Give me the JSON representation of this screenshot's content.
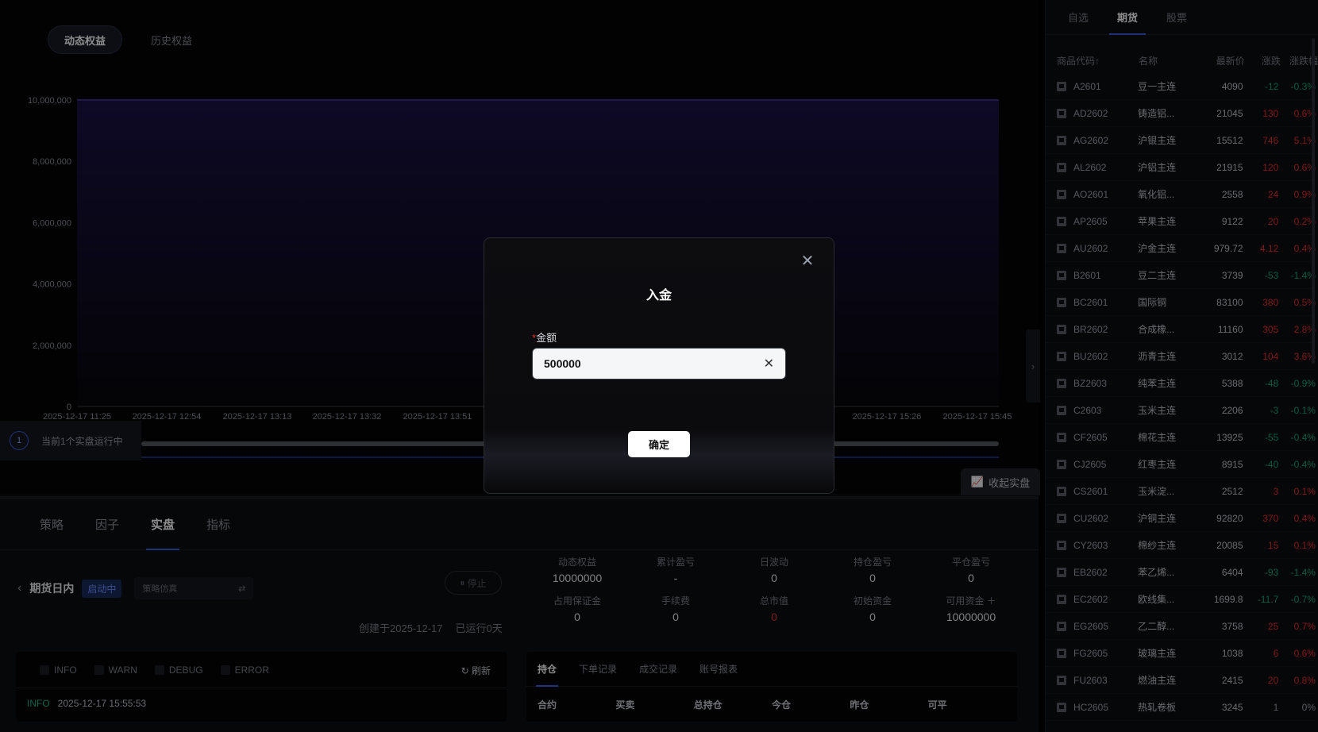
{
  "chart_tabs": [
    "动态权益",
    "历史权益"
  ],
  "chart_data": {
    "type": "area",
    "title": "",
    "xlabel": "",
    "ylabel": "",
    "y_ticks": [
      "0",
      "2,000,000",
      "4,000,000",
      "6,000,000",
      "8,000,000",
      "10,000,000"
    ],
    "x_ticks": [
      "2025-12-17 11:25",
      "2025-12-17 12:54",
      "2025-12-17 13:13",
      "2025-12-17 13:32",
      "2025-12-17 13:51",
      "2025-12-17 15:26",
      "2025-12-17 15:45"
    ],
    "ylim": [
      0,
      10000000
    ],
    "series": [
      {
        "values": [
          10000000,
          10000000
        ]
      }
    ],
    "color": "#3b2a8a"
  },
  "running_badge": {
    "count": "1",
    "text": "当前1个实盘运行中"
  },
  "collapse_label": "收起实盘",
  "bottom_tabs": [
    "策略",
    "因子",
    "实盘",
    "指标"
  ],
  "strategy": {
    "name": "期货日内",
    "status": "启动中",
    "select_placeholder": "策略仿真",
    "stop_label": "停止",
    "created": "创建于2025-12-17",
    "running": "已运行0天"
  },
  "log": {
    "filters": [
      "INFO",
      "WARN",
      "DEBUG",
      "ERROR"
    ],
    "refresh": "刷新",
    "line": {
      "level": "INFO",
      "time": "2025-12-17 15:55:53"
    }
  },
  "stats": [
    {
      "label": "动态权益",
      "value": "10000000"
    },
    {
      "label": "累计盈亏",
      "value": "-"
    },
    {
      "label": "日波动",
      "value": "0"
    },
    {
      "label": "持仓盈亏",
      "value": "0"
    },
    {
      "label": "平仓盈亏",
      "value": "0"
    },
    {
      "label": "占用保证金",
      "value": "0"
    },
    {
      "label": "手续费",
      "value": "0"
    },
    {
      "label": "总市值",
      "value": "0"
    },
    {
      "label": "初始资金",
      "value": "0"
    },
    {
      "label": "可用资金",
      "value": "10000000"
    }
  ],
  "positions": {
    "tabs": [
      "持仓",
      "下单记录",
      "成交记录",
      "账号报表"
    ],
    "headers": [
      "合约",
      "买卖",
      "总持仓",
      "今仓",
      "昨仓",
      "可平"
    ]
  },
  "side": {
    "tabs": [
      "自选",
      "期货",
      "股票"
    ],
    "headers": [
      "商品代码↑",
      "名称",
      "最新价",
      "涨跌",
      "涨跌幅"
    ],
    "rows": [
      [
        "A2601",
        "豆一主连",
        "4090",
        "-12",
        "-0.3%",
        "down"
      ],
      [
        "AD2602",
        "铸造铝...",
        "21045",
        "130",
        "0.6%",
        "up"
      ],
      [
        "AG2602",
        "沪银主连",
        "15512",
        "746",
        "5.1%",
        "up"
      ],
      [
        "AL2602",
        "沪铝主连",
        "21915",
        "120",
        "0.6%",
        "up"
      ],
      [
        "AO2601",
        "氧化铝...",
        "2558",
        "24",
        "0.9%",
        "up"
      ],
      [
        "AP2605",
        "苹果主连",
        "9122",
        "20",
        "0.2%",
        "up"
      ],
      [
        "AU2602",
        "沪金主连",
        "979.72",
        "4.12",
        "0.4%",
        "up"
      ],
      [
        "B2601",
        "豆二主连",
        "3739",
        "-53",
        "-1.4%",
        "down"
      ],
      [
        "BC2601",
        "国际铜",
        "83100",
        "380",
        "0.5%",
        "up"
      ],
      [
        "BR2602",
        "合成橡...",
        "11160",
        "305",
        "2.8%",
        "up"
      ],
      [
        "BU2602",
        "沥青主连",
        "3012",
        "104",
        "3.6%",
        "up"
      ],
      [
        "BZ2603",
        "纯苯主连",
        "5388",
        "-48",
        "-0.9%",
        "down"
      ],
      [
        "C2603",
        "玉米主连",
        "2206",
        "-3",
        "-0.1%",
        "down"
      ],
      [
        "CF2605",
        "棉花主连",
        "13925",
        "-55",
        "-0.4%",
        "down"
      ],
      [
        "CJ2605",
        "红枣主连",
        "8915",
        "-40",
        "-0.4%",
        "down"
      ],
      [
        "CS2601",
        "玉米淀...",
        "2512",
        "3",
        "0.1%",
        "up"
      ],
      [
        "CU2602",
        "沪铜主连",
        "92820",
        "370",
        "0.4%",
        "up"
      ],
      [
        "CY2603",
        "棉纱主连",
        "20085",
        "15",
        "0.1%",
        "up"
      ],
      [
        "EB2602",
        "苯乙烯...",
        "6404",
        "-93",
        "-1.4%",
        "down"
      ],
      [
        "EC2602",
        "欧线集...",
        "1699.8",
        "-11.7",
        "-0.7%",
        "down"
      ],
      [
        "EG2605",
        "乙二醇...",
        "3758",
        "25",
        "0.7%",
        "up"
      ],
      [
        "FG2605",
        "玻璃主连",
        "1038",
        "6",
        "0.6%",
        "up"
      ],
      [
        "FU2603",
        "燃油主连",
        "2415",
        "20",
        "0.8%",
        "up"
      ],
      [
        "HC2605",
        "热轧卷板",
        "3245",
        "1",
        "0%",
        "flat"
      ]
    ]
  },
  "modal": {
    "title": "入金",
    "label": "金额",
    "required_mark": "*",
    "value": "500000",
    "confirm": "确定"
  }
}
